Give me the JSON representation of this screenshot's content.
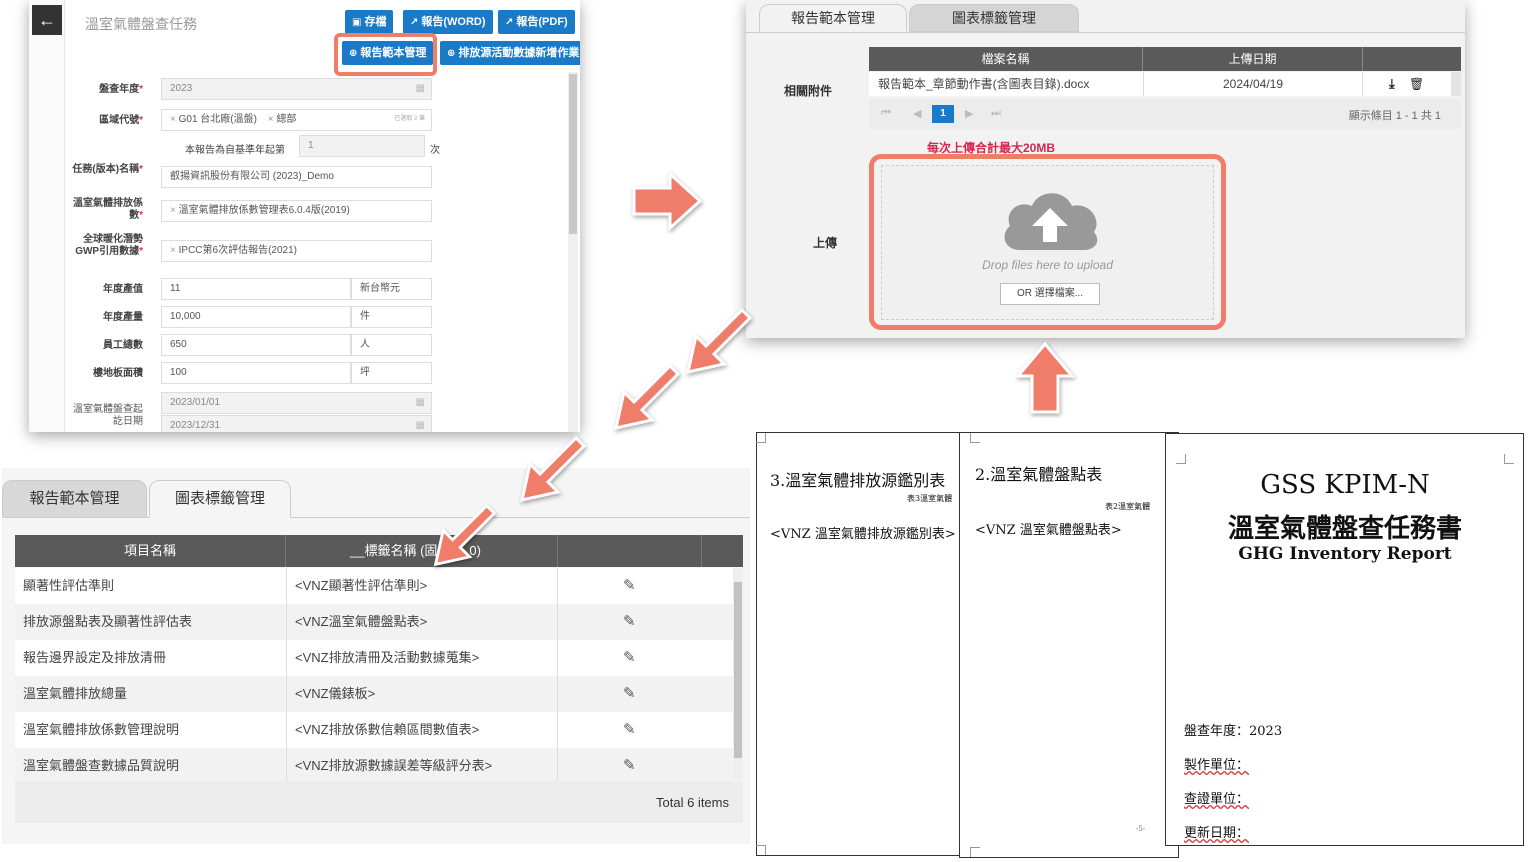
{
  "form": {
    "back_icon": "←",
    "title": "溫室氣體盤查任務",
    "buttons": {
      "save": "存檔",
      "report_word": "報告(WORD)",
      "report_pdf": "報告(PDF)",
      "template_mgmt": "報告範本管理",
      "add_emission": "排放源活動數據新增作業"
    },
    "fields": {
      "year_label": "盤查年度",
      "year_value": "2023",
      "region_label": "區域代號",
      "region_tags": [
        "G01 台北廠(溫盤)",
        "總部"
      ],
      "region_hint": "已選取 2 筆",
      "baseline_label": "本報告為自基準年起第",
      "baseline_value": "1",
      "baseline_unit": "次",
      "task_label": "任務(版本)名稱",
      "task_value": "叡揚資訊股份有限公司 (2023)_Demo",
      "factor_label": "溫室氣體排放係數",
      "factor_value": "溫室氣體排放係數管理表6.0.4版(2019)",
      "gwp_label": "全球暖化潛勢GWP引用數據",
      "gwp_value": "IPCC第6次評估報告(2021)",
      "output_value_label": "年度產值",
      "output_value": "11",
      "output_value_unit": "新台幣元",
      "output_qty_label": "年度產量",
      "output_qty": "10,000",
      "output_qty_unit": "件",
      "employees_label": "員工總數",
      "employees": "650",
      "employees_unit": "人",
      "floor_label": "樓地板面積",
      "floor": "100",
      "floor_unit": "坪",
      "period_label": "溫室氣體盤查起訖日期",
      "period_start": "2023/01/01",
      "period_end": "2023/12/31"
    }
  },
  "upload": {
    "tabs": [
      "報告範本管理",
      "圖表標籤管理"
    ],
    "attachments_label": "相關附件",
    "columns": [
      "檔案名稱",
      "上傳日期"
    ],
    "file_name": "報告範本_章節動作書(含圖表目錄).docx",
    "file_date": "2024/04/19",
    "page": "1",
    "pager_info": "顯示條目 1 - 1 共 1",
    "limit_text": "每次上傳合計最大20MB",
    "upload_label": "上傳",
    "drop_text": "Drop files here to upload",
    "choose_button": "OR 選擇檔案..."
  },
  "tags": {
    "tabs": [
      "報告範本管理",
      "圖表標籤管理"
    ],
    "columns": [
      "項目名稱",
      "__標籤名稱 (固",
      "0)"
    ],
    "rows": [
      {
        "item": "顯著性評估準則",
        "tag": "<VNZ顯著性評估準則>"
      },
      {
        "item": "排放源盤點表及顯著性評估表",
        "tag": "<VNZ溫室氣體盤點表>"
      },
      {
        "item": "報告邊界設定及排放清冊",
        "tag": "<VNZ排放清冊及活動數據蒐集>"
      },
      {
        "item": "溫室氣體排放總量",
        "tag": "<VNZ儀錶板>"
      },
      {
        "item": "溫室氣體排放係數管理說明",
        "tag": "<VNZ排放係數信賴區間數值表>"
      },
      {
        "item": "溫室氣體盤查數據品質說明",
        "tag": "<VNZ排放源數據誤差等級評分表>"
      }
    ],
    "total": "Total 6 items"
  },
  "docs": {
    "page1": {
      "heading": "3.溫室氣體排放源鑑別表",
      "caption": "表3溫室氣體",
      "tag": "<VNZ 溫室氣體排放源鑑別表>"
    },
    "page2": {
      "heading": "2.溫室氣體盤點表",
      "caption": "表2溫室氣體",
      "tag": "<VNZ 溫室氣體盤點表>",
      "page_num": "-5-"
    },
    "cover": {
      "title1": "GSS KPIM-N",
      "title2": "溫室氣體盤查任務書",
      "title3": "GHG Inventory Report",
      "year": "盤查年度：2023",
      "maker": "製作單位：",
      "verifier": "查證單位：",
      "updated": "更新日期："
    }
  },
  "colors": {
    "accent": "#1a7ac7",
    "highlight": "#f07d6a",
    "limit": "#d6284f"
  }
}
